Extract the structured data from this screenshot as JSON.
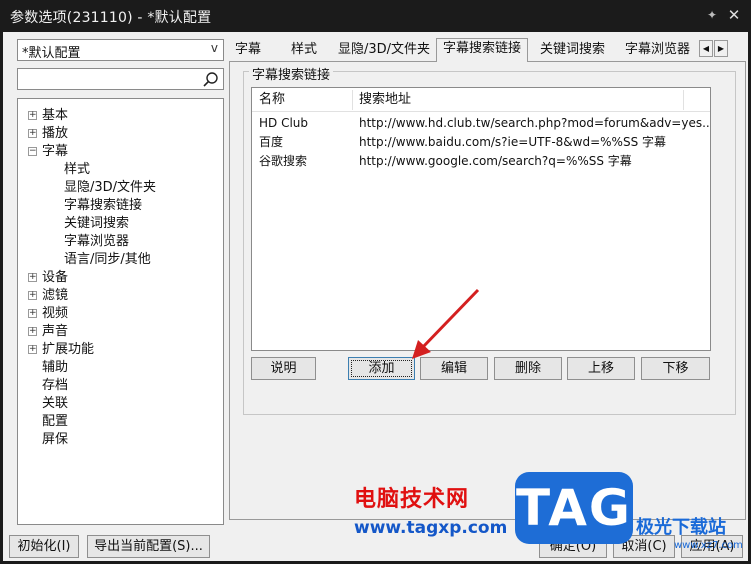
{
  "window": {
    "title": "参数选项(231110) - *默认配置",
    "pin_icon": "pin-icon",
    "close_icon": "close-icon"
  },
  "profile_combo": {
    "value": "*默认配置",
    "arrow": "v"
  },
  "search": {
    "value": "",
    "icon": "search-icon"
  },
  "tree": [
    {
      "label": "基本",
      "expander": "+"
    },
    {
      "label": "播放",
      "expander": "+"
    },
    {
      "label": "字幕",
      "expander": "−"
    },
    {
      "label": "样式",
      "child": true
    },
    {
      "label": "显隐/3D/文件夹",
      "child": true
    },
    {
      "label": "字幕搜索链接",
      "child": true,
      "selected": true
    },
    {
      "label": "关键词搜索",
      "child": true
    },
    {
      "label": "字幕浏览器",
      "child": true
    },
    {
      "label": "语言/同步/其他",
      "child": true
    },
    {
      "label": "设备",
      "expander": "+"
    },
    {
      "label": "滤镜",
      "expander": "+"
    },
    {
      "label": "视频",
      "expander": "+"
    },
    {
      "label": "声音",
      "expander": "+"
    },
    {
      "label": "扩展功能",
      "expander": "+"
    },
    {
      "label": "辅助"
    },
    {
      "label": "存档"
    },
    {
      "label": "关联"
    },
    {
      "label": "配置"
    },
    {
      "label": "屏保"
    }
  ],
  "tabs": [
    {
      "label": "字幕"
    },
    {
      "label": "样式"
    },
    {
      "label": "显隐/3D/文件夹"
    },
    {
      "label": "字幕搜索链接",
      "active": true
    },
    {
      "label": "关键词搜索"
    },
    {
      "label": "字幕浏览器"
    }
  ],
  "tab_nav": {
    "prev": "◀",
    "next": "▶"
  },
  "group": {
    "title": "字幕搜索链接",
    "columns": [
      "名称",
      "搜索地址"
    ],
    "rows": [
      {
        "name": "HD Club",
        "url": "http://www.hd.club.tw/search.php?mod=forum&adv=yes..."
      },
      {
        "name": "百度",
        "url": "http://www.baidu.com/s?ie=UTF-8&wd=%%SS 字幕"
      },
      {
        "name": "谷歌搜索",
        "url": "http://www.google.com/search?q=%%SS 字幕"
      }
    ],
    "buttons": {
      "help": "说明",
      "add": "添加",
      "edit": "编辑",
      "delete": "删除",
      "up": "上移",
      "down": "下移"
    }
  },
  "footer": {
    "init": "初始化(I)",
    "export": "导出当前配置(S)...",
    "ok": "确定(O)",
    "cancel": "取消(C)",
    "apply": "应用(A)"
  },
  "watermark": {
    "title": "电脑技术网",
    "url": "www.tagxp.com",
    "badge": "TAG",
    "site": "极光下载站",
    "site_url": "www.xz7.com"
  },
  "colors": {
    "titlebar": "#1b1b1b",
    "dialog": "#f0f0f0",
    "annotation_arrow": "#d42020",
    "watermark_red": "#e01010",
    "watermark_blue": "#1e6dd6"
  }
}
